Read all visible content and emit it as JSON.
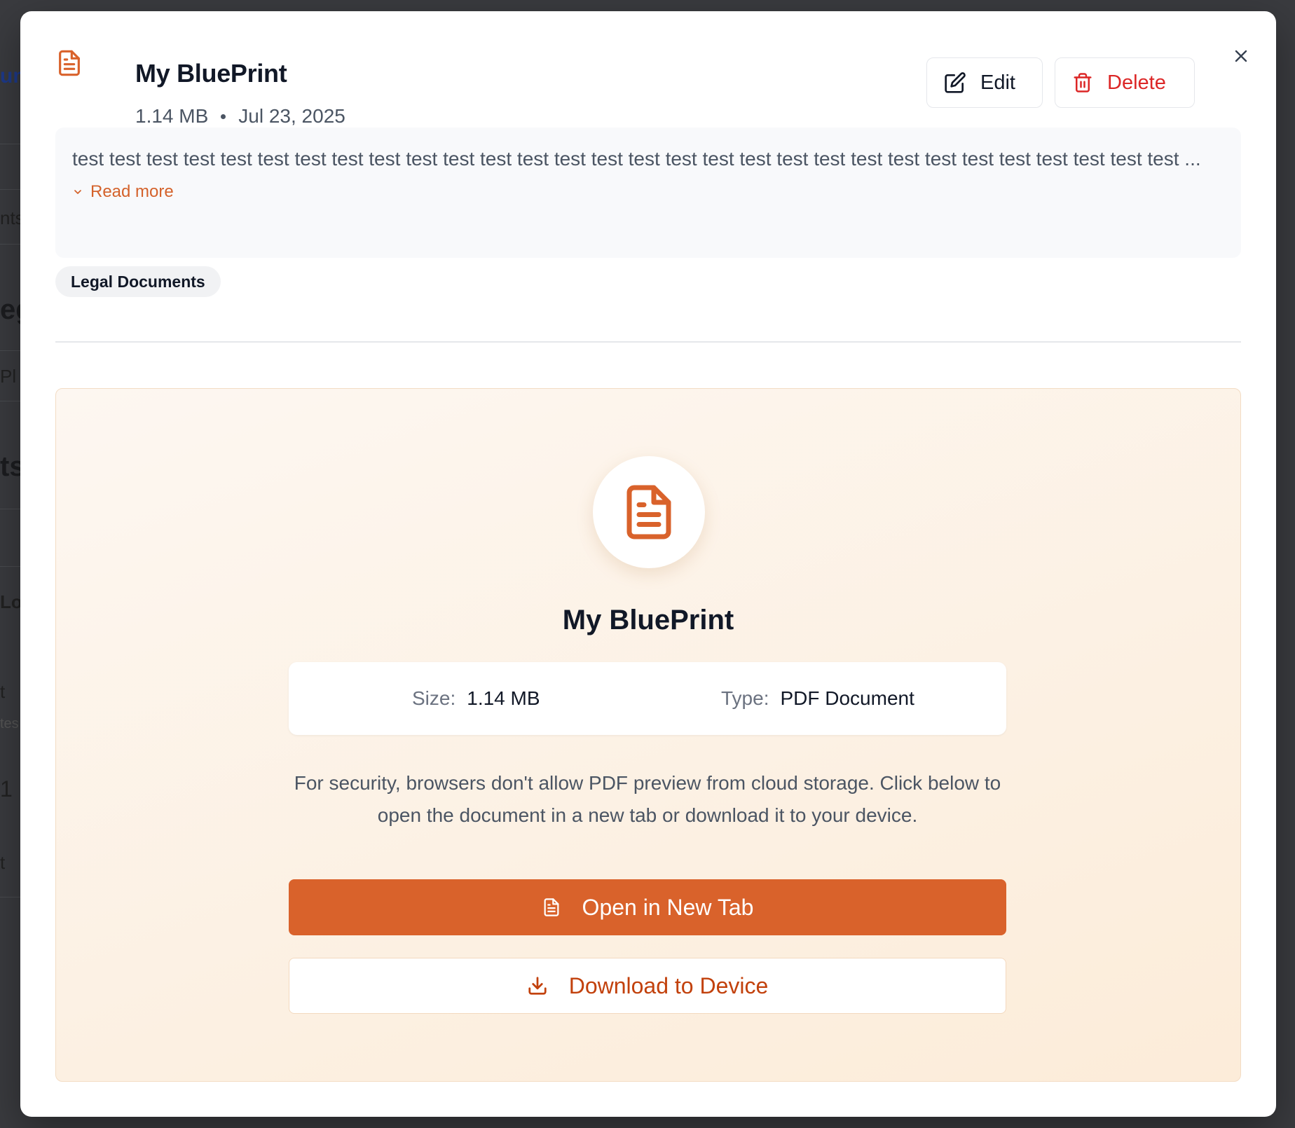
{
  "background": {
    "fragments": [
      "um",
      "nts",
      "eg",
      "Pl",
      "ts",
      "Lo",
      "t",
      "tes",
      "1",
      "t"
    ]
  },
  "document": {
    "title": "My BluePrint",
    "size": "1.14 MB",
    "date": "Jul 23, 2025",
    "description": "test test test test test test test test test test test test test test test test test test test test test test test test test test test test test test ...",
    "read_more_label": "Read more",
    "tag": "Legal Documents"
  },
  "actions": {
    "edit_label": "Edit",
    "delete_label": "Delete"
  },
  "preview": {
    "title": "My BluePrint",
    "size_label": "Size:",
    "size_value": "1.14 MB",
    "type_label": "Type:",
    "type_value": "PDF Document",
    "notice": "For security, browsers don't allow PDF preview from cloud storage. Click below to open the document in a new tab or download it to your device.",
    "open_label": "Open in New Tab",
    "download_label": "Download to Device"
  },
  "colors": {
    "accent": "#d9622b",
    "danger": "#dc2626",
    "preview_bg": "#fcecd9"
  }
}
